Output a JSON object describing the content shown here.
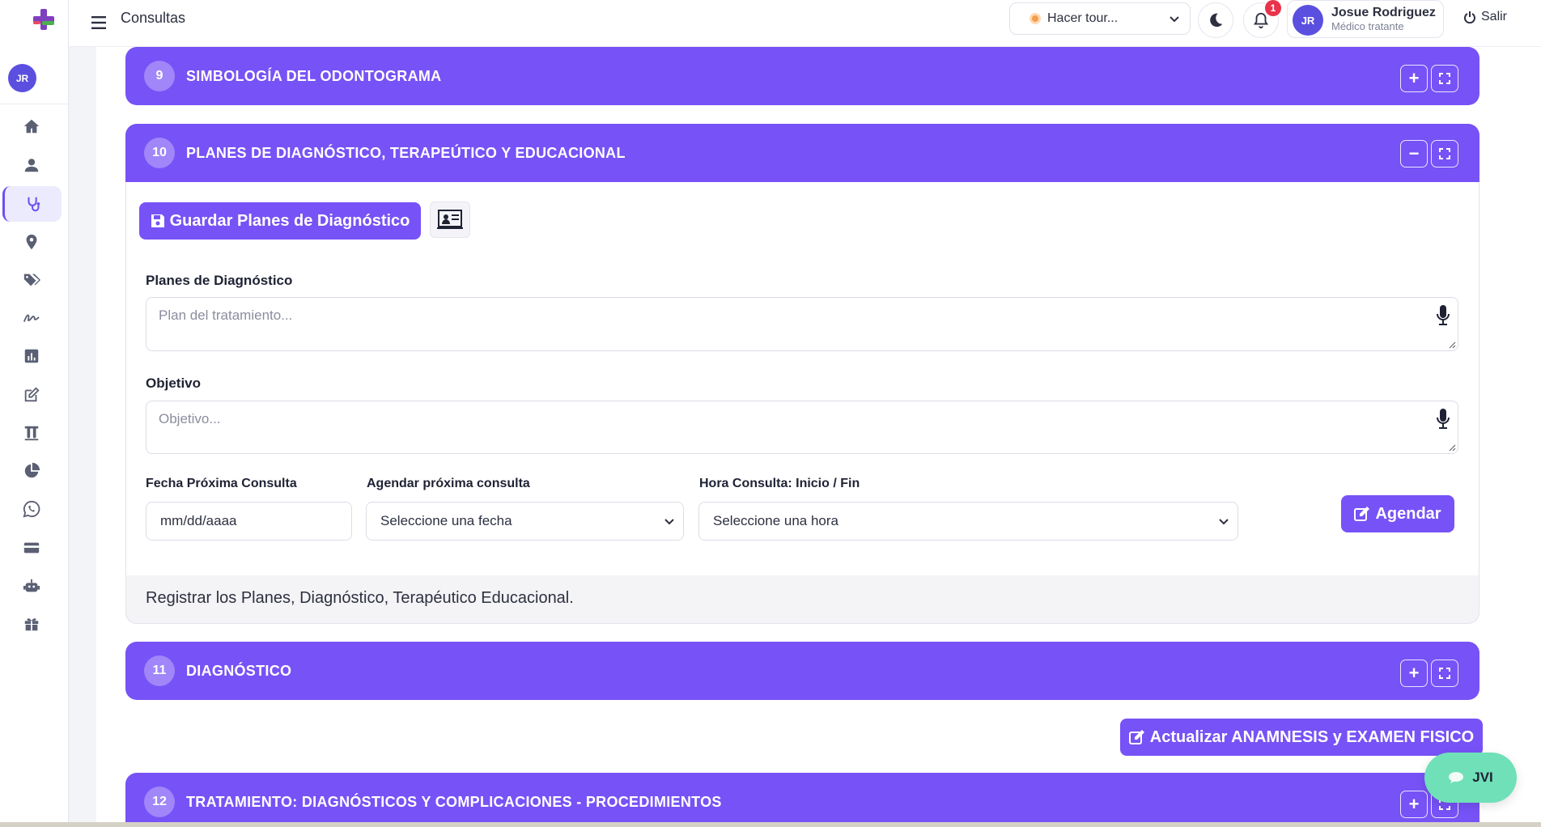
{
  "topbar": {
    "page_title": "Consultas",
    "tour_label": "Hacer tour...",
    "notifications_count": "1",
    "user_initials": "JR",
    "user_name": "Josue Rodriguez",
    "user_role": "Médico tratante",
    "logout_label": "Salir"
  },
  "sidebar": {
    "avatar_initials": "JR",
    "items": [
      "home-icon",
      "user-icon",
      "stethoscope-icon",
      "location-icon",
      "tags-icon",
      "signature-icon",
      "chart-bar-icon",
      "edit-icon",
      "lab-icon",
      "pie-chart-icon",
      "whatsapp-icon",
      "credit-card-icon",
      "robot-icon",
      "gift-icon"
    ],
    "active_item": "stethoscope-icon"
  },
  "sections": {
    "s9": {
      "number": "9",
      "title": "SIMBOLOGÍA DEL ODONTOGRAMA"
    },
    "s10": {
      "number": "10",
      "title": "PLANES DE DIAGNÓSTICO, TERAPEÚTICO Y EDUCACIONAL"
    },
    "s11": {
      "number": "11",
      "title": "DIAGNÓSTICO"
    },
    "s12": {
      "number": "12",
      "title": "TRATAMIENTO: DIAGNÓSTICOS Y COMPLICACIONES - PROCEDIMIENTOS"
    }
  },
  "form": {
    "save_button": "Guardar Planes de Diagnóstico",
    "planes_label": "Planes de Diagnóstico",
    "planes_placeholder": "Plan del tratamiento...",
    "objetivo_label": "Objetivo",
    "objetivo_placeholder": "Objetivo...",
    "fecha_label": "Fecha Próxima Consulta",
    "fecha_value": "mm/dd/aaaa",
    "agendar_label": "Agendar próxima consulta",
    "agendar_value": "Seleccione una fecha",
    "hora_label": "Hora Consulta: Inicio / Fin",
    "hora_value": "Seleccione una hora",
    "agendar_button": "Agendar",
    "footer_text": "Registrar los Planes, Diagnóstico, Terapéutico Educacional."
  },
  "actions": {
    "update_button": "Actualizar ANAMNESIS y EXAMEN FISICO"
  },
  "chat": {
    "label": "JVI"
  },
  "colors": {
    "primary": "#7752f6",
    "avatar": "#5b4fe0",
    "chat": "#6fe0b8",
    "badge": "#e8334a"
  }
}
